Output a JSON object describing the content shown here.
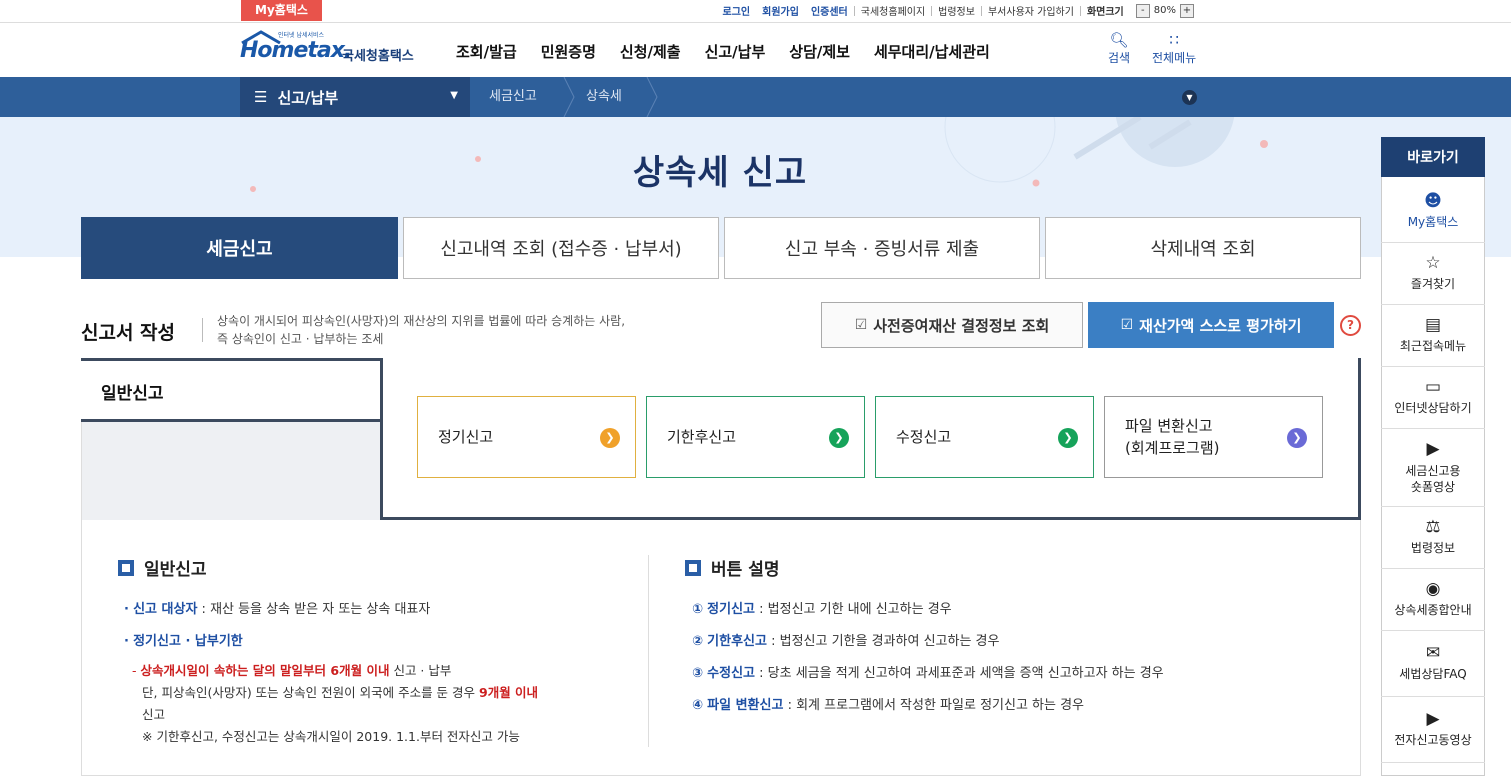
{
  "top": {
    "my_hometax": "My홈택스",
    "links": [
      "로그인",
      "회원가입",
      "인증센터",
      "국세청홈페이지",
      "법령정보",
      "부서사용자 가입하기",
      "화면크기"
    ],
    "zoom": "80%",
    "zoom_minus": "-",
    "zoom_plus": "+"
  },
  "header": {
    "logo_small": "인터넷 납세서비스",
    "logo_main": "Hometax.",
    "logo_sub": "국세청홈택스",
    "nav": [
      "조회/발급",
      "민원증명",
      "신청/제출",
      "신고/납부",
      "상담/제보",
      "세무대리/납세관리"
    ],
    "search": "검색",
    "all_menu": "전체메뉴"
  },
  "navbar": {
    "menu": "신고/납부",
    "crumb1": "세금신고",
    "crumb2": "상속세"
  },
  "page": {
    "title": "상속세 신고",
    "tabs": [
      "세금신고",
      "신고내역 조회 (접수증 · 납부서)",
      "신고 부속 · 증빙서류 제출",
      "삭제내역 조회"
    ]
  },
  "section": {
    "title": "신고서 작성",
    "desc1": "상속이 개시되어 피상속인(사망자)의 재산상의 지위를 법률에 따라 승계하는 사람,",
    "desc2": "즉 상속인이 신고 · 납부하는 조세",
    "btn_pre": "사전증여재산 결정정보 조회",
    "btn_self": "재산가액 스스로 평가하기",
    "help": "?"
  },
  "general": {
    "label": "일반신고",
    "options": [
      {
        "line1": "정기신고",
        "line2": "",
        "color": "#f0a12a",
        "border": "#e0b040"
      },
      {
        "line1": "기한후신고",
        "line2": "",
        "color": "#16a35a",
        "border": "#2a9d6a"
      },
      {
        "line1": "수정신고",
        "line2": "",
        "color": "#16a35a",
        "border": "#2a9d6a"
      },
      {
        "line1": "파일 변환신고",
        "line2": "(회계프로그램)",
        "color": "#6a6ad6",
        "border": "#999999"
      }
    ]
  },
  "info_left": {
    "heading": "일반신고",
    "b1_label": "신고 대상자",
    "b1_text": " : 재산 등을 상속 받은 자 또는 상속 대표자",
    "b2_label": "정기신고 · 납부기한",
    "dash_red": "상속개시일이 속하는 달의 말일부터 6개월 이내",
    "dash_tail": " 신고 · 납부",
    "line2_a": "단, 피상속인(사망자) 또는 상속인 전원이 외국에 주소를 둔 경우 ",
    "line2_red": "9개월 이내",
    "line3": "신고",
    "note": "※ 기한후신고, 수정신고는 상속개시일이 2019. 1.1.부터 전자신고 가능"
  },
  "info_right": {
    "heading": "버튼 설명",
    "items": [
      {
        "num": "①",
        "label": "정기신고",
        "text": " : 법정신고 기한 내에 신고하는 경우"
      },
      {
        "num": "②",
        "label": "기한후신고",
        "text": " : 법정신고 기한을 경과하여 신고하는 경우"
      },
      {
        "num": "③",
        "label": "수정신고",
        "text": " : 당초 세금을 적게 신고하여 과세표준과 세액을 증액 신고하고자 하는 경우"
      },
      {
        "num": "④",
        "label": "파일 변환신고",
        "text": " : 회계 프로그램에서 작성한 파일로 정기신고 하는 경우"
      }
    ]
  },
  "quick": {
    "title": "바로가기",
    "items": [
      {
        "label": "My홈택스",
        "label2": ""
      },
      {
        "label": "즐겨찾기",
        "label2": ""
      },
      {
        "label": "최근접속메뉴",
        "label2": ""
      },
      {
        "label": "인터넷상담하기",
        "label2": ""
      },
      {
        "label": "세금신고용",
        "label2": "숏폼영상"
      },
      {
        "label": "법령정보",
        "label2": ""
      },
      {
        "label": "상속세종합안내",
        "label2": ""
      },
      {
        "label": "세법상담FAQ",
        "label2": ""
      },
      {
        "label": "전자신고동영상",
        "label2": ""
      }
    ]
  }
}
